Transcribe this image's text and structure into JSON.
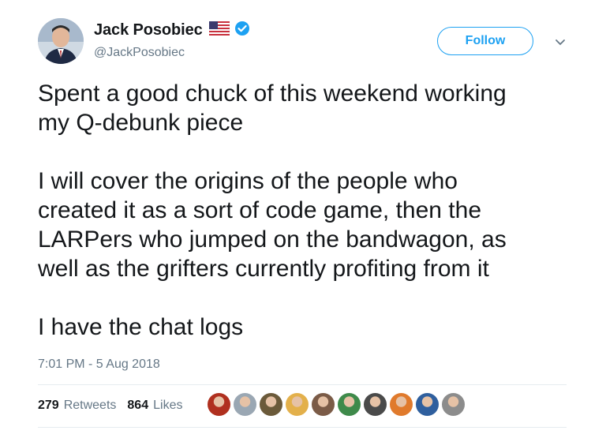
{
  "author": {
    "display_name": "Jack Posobiec",
    "handle": "@JackPosobiec",
    "flag_icon": "us-flag-icon",
    "verified_icon": "verified-badge-icon",
    "avatar_icon": "profile-photo"
  },
  "follow_button": {
    "label": "Follow",
    "color": "#1da1f2"
  },
  "more_menu_icon": "chevron-down-icon",
  "tweet": {
    "lines": [
      "Spent a good chuck of this weekend working",
      "my Q-debunk piece",
      "",
      "I will cover the origins of the people who",
      "created it as a sort of code game, then the",
      "LARPers who jumped on the bandwagon, as",
      "well as the grifters currently profiting from it",
      "",
      "I have the chat logs"
    ],
    "timestamp": "7:01 PM - 5 Aug 2018"
  },
  "stats": {
    "retweets_count": "279",
    "retweets_label": "Retweets",
    "likes_count": "864",
    "likes_label": "Likes"
  },
  "likers": [
    {
      "color": "#b0301f"
    },
    {
      "color": "#9aa7b3"
    },
    {
      "color": "#6b5a3a"
    },
    {
      "color": "#e3b04b"
    },
    {
      "color": "#7b5b47"
    },
    {
      "color": "#3e8a4a"
    },
    {
      "color": "#4a4a4a"
    },
    {
      "color": "#e07a2c"
    },
    {
      "color": "#2f5f9e"
    },
    {
      "color": "#8c8c8c"
    }
  ],
  "colors": {
    "text": "#14171a",
    "muted": "#657786",
    "accent": "#1da1f2"
  }
}
